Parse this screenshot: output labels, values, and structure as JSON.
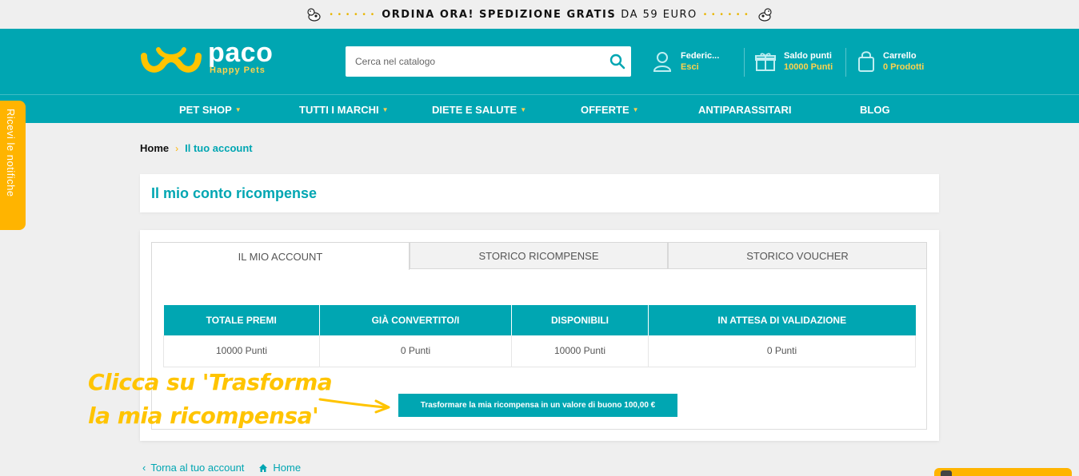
{
  "banner": {
    "bold_text": "ORDINA ORA! SPEDIZIONE GRATIS",
    "thin_text": "DA 59 EURO"
  },
  "header": {
    "logo_name": "paco",
    "logo_tagline": "Happy Pets",
    "search_placeholder": "Cerca nel catalogo",
    "account": {
      "name": "Federic...",
      "action": "Esci"
    },
    "points": {
      "label": "Saldo punti",
      "value": "10000 Punti"
    },
    "cart": {
      "label": "Carrello",
      "value": "0 Prodotti"
    }
  },
  "nav": {
    "items": [
      {
        "label": "PET SHOP"
      },
      {
        "label": "TUTTI I MARCHI"
      },
      {
        "label": "DIETE E SALUTE"
      },
      {
        "label": "OFFERTE"
      },
      {
        "label": "ANTIPARASSITARI"
      },
      {
        "label": "BLOG"
      }
    ]
  },
  "notification_tab": "Ricevi le notifiche",
  "breadcrumb": {
    "home": "Home",
    "separator": "›",
    "current": "Il tuo account"
  },
  "page_title": "Il mio conto ricompense",
  "tabs": [
    {
      "label": "Il mio account",
      "active": true
    },
    {
      "label": "Storico ricompense",
      "active": false
    },
    {
      "label": "Storico voucher",
      "active": false
    }
  ],
  "table": {
    "headers": [
      "TOTALE PREMI",
      "GIÀ CONVERTITO/I",
      "DISPONIBILI",
      "IN ATTESA DI VALIDAZIONE"
    ],
    "row": [
      "10000 Punti",
      "0 Punti",
      "10000 Punti",
      "0 Punti"
    ]
  },
  "convert_button": "Trasformare la mia ricompensa in un valore di buono 100,00 €",
  "annotation": {
    "line1": "Clicca su 'Trasforma",
    "line2": "la mia ricompensa'"
  },
  "footer_links": {
    "back": "Torna al tuo account",
    "home": "Home"
  },
  "colors": {
    "primary": "#00a6b2",
    "accent": "#ffb400",
    "highlight": "#ffd34d"
  }
}
